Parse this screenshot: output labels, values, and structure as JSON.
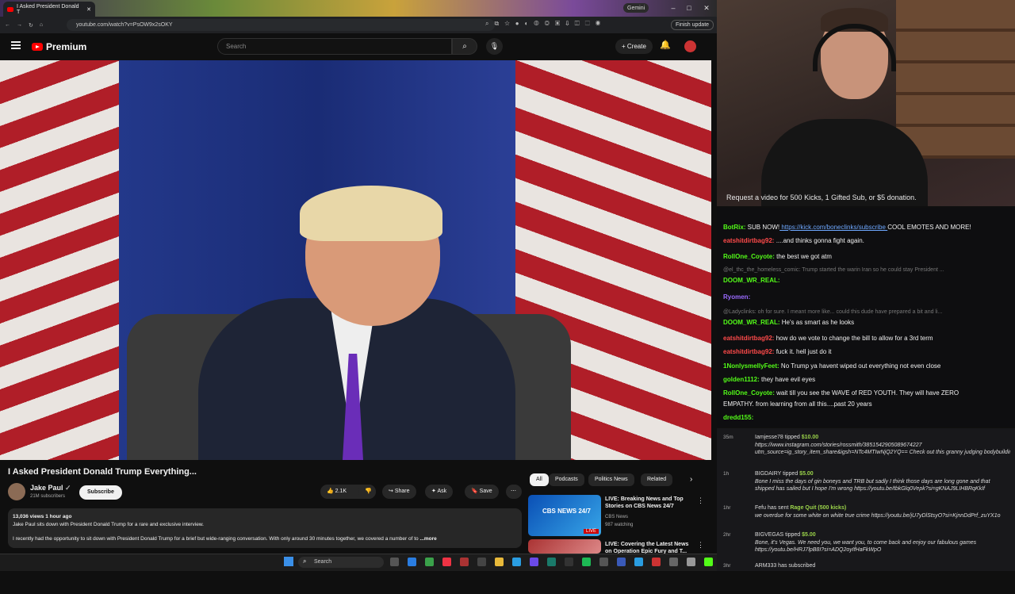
{
  "browser": {
    "tab_title": "I Asked President Donald T",
    "gemini": "Gemini",
    "url": "youtube.com/watch?v=PsOW9x2sOKY",
    "finish_update": "Finish update"
  },
  "youtube": {
    "brand": "Premium",
    "search_placeholder": "Search",
    "create_label": "Create",
    "video_title": "I Asked President Donald Trump Everything...",
    "channel_name": "Jake Paul",
    "subscribers": "21M subscribers",
    "subscribe_label": "Subscribe",
    "likes": "2.1K",
    "share_label": "Share",
    "ask_label": "Ask",
    "save_label": "Save",
    "description": {
      "stats": "13,036 views  1 hour ago",
      "line1": "Jake Paul sits down with President Donald Trump for a rare and exclusive interview.",
      "line2": "I recently had the opportunity to sit down with President Donald Trump for a brief but wide-ranging conversation. With only around 30 minutes together, we covered a number of to",
      "more": "...more"
    },
    "chips": [
      "All",
      "Podcasts",
      "Politics News",
      "Related"
    ],
    "related": [
      {
        "title": "LIVE: Breaking News and Top Stories on CBS News 24/7",
        "channel": "CBS News",
        "meta": "987 watching",
        "thumb_label": "CBS NEWS 24/7",
        "badge": "LIVE"
      },
      {
        "title": "LIVE: Covering the Latest News on Operation Epic Fury and T...",
        "channel": "",
        "meta": "",
        "thumb_label": "",
        "badge": ""
      }
    ],
    "taskbar_search": "Search"
  },
  "stream": {
    "request_banner": "Request a video for 500 Kicks, 1 Gifted Sub, or $5 donation.",
    "chat": [
      {
        "user": "BotRix:",
        "text": "SUB NOW!",
        "link": "https://kick.com/boneclinks/subscribe",
        "tail": "COOL EMOTES AND MORE!",
        "ucolor": "#53fc18"
      },
      {
        "user": "eatshitdirtbag92:",
        "text": "....and thinks gonna fight again.",
        "ucolor": "#ff4a4a"
      },
      {
        "user": "RollOne_Coyote:",
        "text": "the best we got atm",
        "ucolor": "#53fc18"
      },
      {
        "user": "",
        "text": "@el_thc_the_homeless_comic: Trump started the warin Iran so he could stay President ...",
        "faint": true
      },
      {
        "user": "DOOM_WR_REAL:",
        "text": "",
        "ucolor": "#53fc18"
      },
      {
        "user": "Ryomen:",
        "text": "",
        "ucolor": "#9b6bff"
      },
      {
        "user": "",
        "text": "@Ladyclinks: oh for sure. I meant more like... could this dude have prepared a bit and li...",
        "faint": true
      },
      {
        "user": "DOOM_WR_REAL:",
        "text": "He's as smart as he looks",
        "ucolor": "#53fc18"
      },
      {
        "user": "eatshitdirtbag92:",
        "text": "how do we vote to change the bill to allow for a 3rd term",
        "ucolor": "#ff4a4a"
      },
      {
        "user": "eatshitdirtbag92:",
        "text": "fuck it. hell just do it",
        "ucolor": "#ff4a4a"
      },
      {
        "user": "1NonlysmellyFeet:",
        "text": "No Trump ya havent wiped out everything not even close",
        "ucolor": "#53fc18"
      },
      {
        "user": "golden1112:",
        "text": "they have evil eyes",
        "ucolor": "#53fc18"
      },
      {
        "user": "RollOne_Coyote:",
        "text": "wait till you see the WAVE of RED YOUTH. They will have ZERO",
        "ucolor": "#53fc18"
      },
      {
        "user": "",
        "text": "EMPATHY. from learning from all this....past 20 years",
        "ucolor": "#53fc18"
      },
      {
        "user": "dredd155:",
        "text": "",
        "ucolor": "#53fc18"
      }
    ],
    "tips": [
      {
        "time": "35m",
        "name": "Iamjesse78 tipped",
        "amount": "$10.00",
        "body": "https://www.instagram.com/stories/rossmith/3851542905089674227",
        "body2": "utm_source=ig_story_item_share&igsh=NTc4MTIwNjQ2YQ== Check out this granny judging bodybuilding gurus"
      },
      {
        "time": "1h",
        "name": "BIGDAIRY tipped",
        "amount": "$5.00",
        "body": "Bone I miss the days of gin boneys and TRB but sadly I think those days are long gone and that",
        "body2": "shipped has sailed but I hope I'm wrong https://youtu.be/tbkGlq0Vepk?si=gKNAJ9LIHBRqKkIf"
      },
      {
        "time": "1hr",
        "name": "Fefu has sent",
        "amount": "Rage Quit (500 kicks)",
        "body": "we overdue for some white on white true crime https://youtu.be/jU7yDlStsyO?si=KjnnDdPrf_zuYX1o",
        "body2": ""
      },
      {
        "time": "2hr",
        "name": "BIGVEGAS tipped",
        "amount": "$5.00",
        "body": "Bone, it's Vegas. We need you, we want you, to come back and enjoy our fabulous games",
        "body2": "https://youtu.be/HRJ7lpB8I?si=ADQ2oyIfHaFkWpO"
      },
      {
        "time": "3hr",
        "name": "ARM333 has subscribed",
        "amount": "",
        "body": "",
        "body2": ""
      }
    ]
  }
}
